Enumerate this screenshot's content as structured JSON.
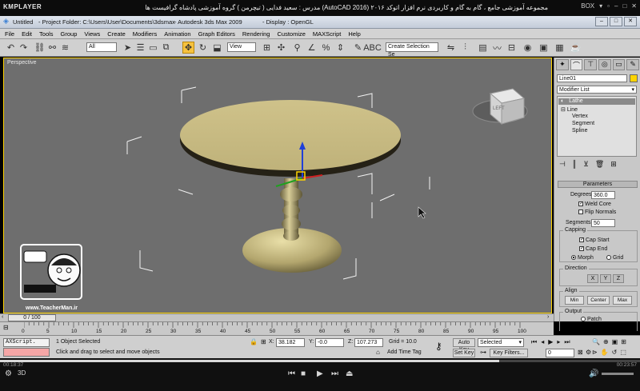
{
  "player": {
    "logo": "KMPLAYER",
    "title": "مجموعه آموزشی جامع ، گام به گام و کاربردی نرم افزار  اتوکد ۲۰۱۶  (AutoCAD 2016)  مدرس : سعید فدایی ( تیچرمن ) گروه آموزشی پادشاه گرافیست ها",
    "box_label": "BOX",
    "time_elapsed": "00:18:37",
    "time_total": "00:23:57",
    "progress": 0.78
  },
  "app": {
    "doc_name": "Untitled",
    "project_folder": "- Project Folder: C:\\Users\\User\\Documents\\3dsmax",
    "product": "- Autodesk 3ds Max  2009",
    "display": "- Display : OpenGL"
  },
  "menu": [
    "File",
    "Edit",
    "Tools",
    "Group",
    "Views",
    "Create",
    "Modifiers",
    "Animation",
    "Graph Editors",
    "Rendering",
    "Customize",
    "MAXScript",
    "Help"
  ],
  "toolbar": {
    "selection_filter": "All",
    "ref_coord": "View",
    "named_selection": "Create Selection Se"
  },
  "viewport": {
    "label": "Perspective",
    "viewcube_face": "LEFT"
  },
  "command_panel": {
    "object_name": "Line01",
    "modifier_list": "Modifier List",
    "stack": [
      "Lathe",
      "Line",
      "Vertex",
      "Segment",
      "Spline"
    ],
    "parameters_title": "Parameters",
    "degrees_label": "Degrees:",
    "degrees_value": "360.0",
    "weld_core": "Weld Core",
    "flip_normals": "Flip Normals",
    "segments_label": "Segments:",
    "segments_value": "50",
    "capping_title": "Capping",
    "cap_start": "Cap Start",
    "cap_end": "Cap End",
    "morph": "Morph",
    "grid": "Grid",
    "direction_title": "Direction",
    "dir_x": "X",
    "dir_y": "Y",
    "dir_z": "Z",
    "align_title": "Align",
    "align_min": "Min",
    "align_center": "Center",
    "align_max": "Max",
    "output_title": "Output",
    "patch": "Patch",
    "mesh": "Mesh"
  },
  "timeline": {
    "frame": "0 / 100",
    "ticks": [
      "0",
      "5",
      "10",
      "15",
      "20",
      "25",
      "30",
      "35",
      "40",
      "45",
      "50",
      "55",
      "60",
      "65",
      "70",
      "75",
      "80",
      "85",
      "90",
      "95",
      "100"
    ]
  },
  "status": {
    "maxscript": "AXScript.",
    "selected": "1 Object Selected",
    "prompt": "Click and drag to select and move objects",
    "x_label": "X:",
    "x_value": "38.182",
    "y_label": "Y:",
    "y_value": "-0.0",
    "z_label": "Z:",
    "z_value": "107.273",
    "grid": "Grid = 10.0",
    "add_time_tag": "Add Time Tag",
    "auto_key": "Auto Key",
    "set_key": "Set Key",
    "key_mode": "Selected",
    "key_filters": "Key Filters...",
    "frame_field": "0"
  },
  "watermark": {
    "url": "www.TeacherMan.ir"
  },
  "colors": {
    "selection_highlight": "#ffd400",
    "viewport_bg": "#6e6e6e",
    "table_top": "#c9bc84"
  }
}
